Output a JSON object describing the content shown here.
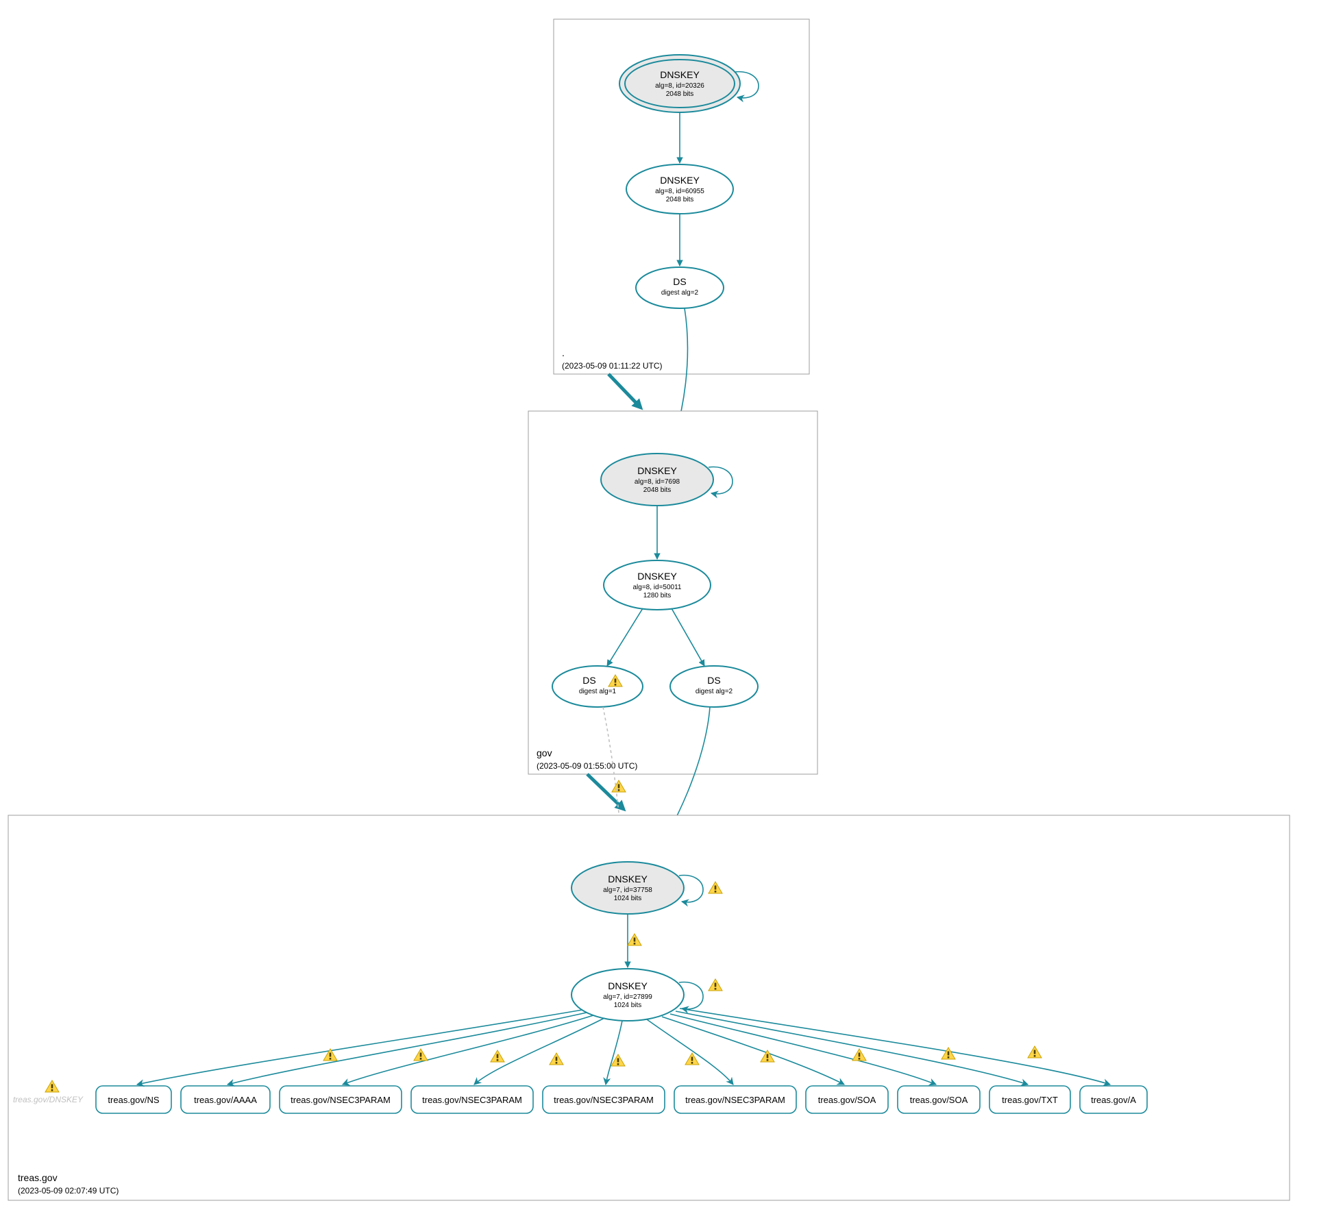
{
  "zones": {
    "root": {
      "label": ".",
      "timestamp": "(2023-05-09 01:11:22 UTC)",
      "nodes": {
        "ksk": {
          "title": "DNSKEY",
          "l2": "alg=8, id=20326",
          "l3": "2048 bits"
        },
        "zsk": {
          "title": "DNSKEY",
          "l2": "alg=8, id=60955",
          "l3": "2048 bits"
        },
        "ds": {
          "title": "DS",
          "l2": "digest alg=2"
        }
      }
    },
    "gov": {
      "label": "gov",
      "timestamp": "(2023-05-09 01:55:00 UTC)",
      "nodes": {
        "ksk": {
          "title": "DNSKEY",
          "l2": "alg=8, id=7698",
          "l3": "2048 bits"
        },
        "zsk": {
          "title": "DNSKEY",
          "l2": "alg=8, id=50011",
          "l3": "1280 bits"
        },
        "ds1": {
          "title": "DS",
          "l2": "digest alg=1"
        },
        "ds2": {
          "title": "DS",
          "l2": "digest alg=2"
        }
      }
    },
    "treas": {
      "label": "treas.gov",
      "timestamp": "(2023-05-09 02:07:49 UTC)",
      "nodes": {
        "ksk": {
          "title": "DNSKEY",
          "l2": "alg=7, id=37758",
          "l3": "1024 bits"
        },
        "zsk": {
          "title": "DNSKEY",
          "l2": "alg=7, id=27899",
          "l3": "1024 bits"
        }
      },
      "ghost": "treas.gov/DNSKEY",
      "rr": {
        "ns": "treas.gov/NS",
        "aaaa": "treas.gov/AAAA",
        "n3p1": "treas.gov/NSEC3PARAM",
        "n3p2": "treas.gov/NSEC3PARAM",
        "n3p3": "treas.gov/NSEC3PARAM",
        "n3p4": "treas.gov/NSEC3PARAM",
        "soa1": "treas.gov/SOA",
        "soa2": "treas.gov/SOA",
        "txt": "treas.gov/TXT",
        "a": "treas.gov/A"
      }
    }
  },
  "colors": {
    "teal": "#1b8a9b",
    "greyFill": "#e8e8e8",
    "zoneStroke": "#9c9c9c",
    "dash": "#c0c0c0"
  }
}
